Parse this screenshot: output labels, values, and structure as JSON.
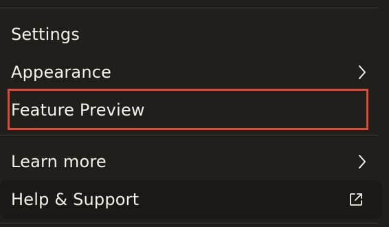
{
  "menu": {
    "section_title": "Settings",
    "items": [
      {
        "label": "Appearance",
        "icon": "chevron-right-icon"
      },
      {
        "label": "Feature Preview",
        "icon": null
      },
      {
        "label": "Learn more",
        "icon": "chevron-right-icon"
      },
      {
        "label": "Help & Support",
        "icon": "external-link-icon"
      }
    ]
  },
  "colors": {
    "background": "#201f1c",
    "text": "#f4f2ec",
    "divider": "#3a3935",
    "highlight_border": "#e34a33",
    "hover_row": "#1a1916"
  }
}
